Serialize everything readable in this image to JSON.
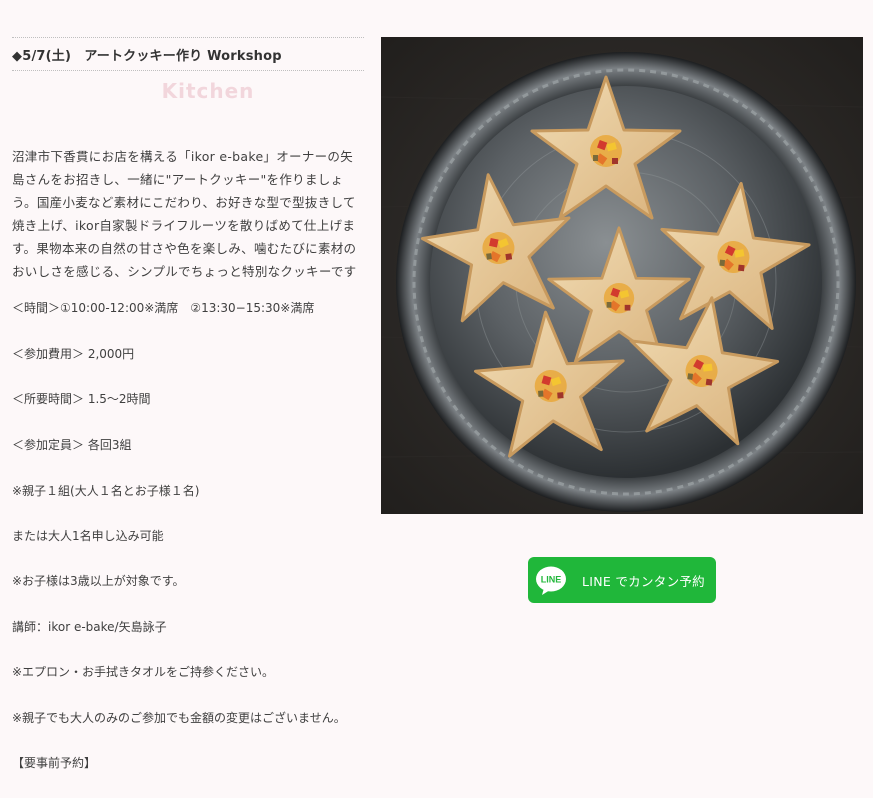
{
  "event": {
    "title": "◆5/7(土)　アートクッキー作り Workshop",
    "category": "Kitchen",
    "description": "沼津市下香貫にお店を構える「ikor e-bake」オーナーの矢島さんをお招きし、一緒に\"アートクッキー\"を作りましょう。国産小麦など素材にこだわり、お好きな型で型抜きして焼き上げ、ikor自家製ドライフルーツを散りばめて仕上げます。果物本来の自然の甘さや色を楽しみ、噛むたびに素材のおいしさを感じる、シンプルでちょっと特別なクッキーです",
    "time": "＜時間＞①10:00-12:00※満席　②13:30−15:30※満席",
    "fee": "＜参加費用＞ 2,000円",
    "duration": "＜所要時間＞ 1.5〜2時間",
    "capacity": "＜参加定員＞ 各回3組",
    "note_parent_child": "※親子１組(大人１名とお子様１名)",
    "note_adult": "または大人1名申し込み可能",
    "note_age": "※お子様は3歳以上が対象です。",
    "instructor": "講師：ikor e-bake/矢島詠子",
    "note_items": "※エプロン・お手拭きタオルをご持参ください。",
    "note_price": "※親子でも大人のみのご参加でも金額の変更はございません。",
    "reservation": "【要事前予約】"
  },
  "line_button": {
    "logo_text": "LINE",
    "label": "LINE でカンタン予約",
    "color": "#20b73a"
  },
  "photo": {
    "icon": "star-cookies-photo"
  }
}
